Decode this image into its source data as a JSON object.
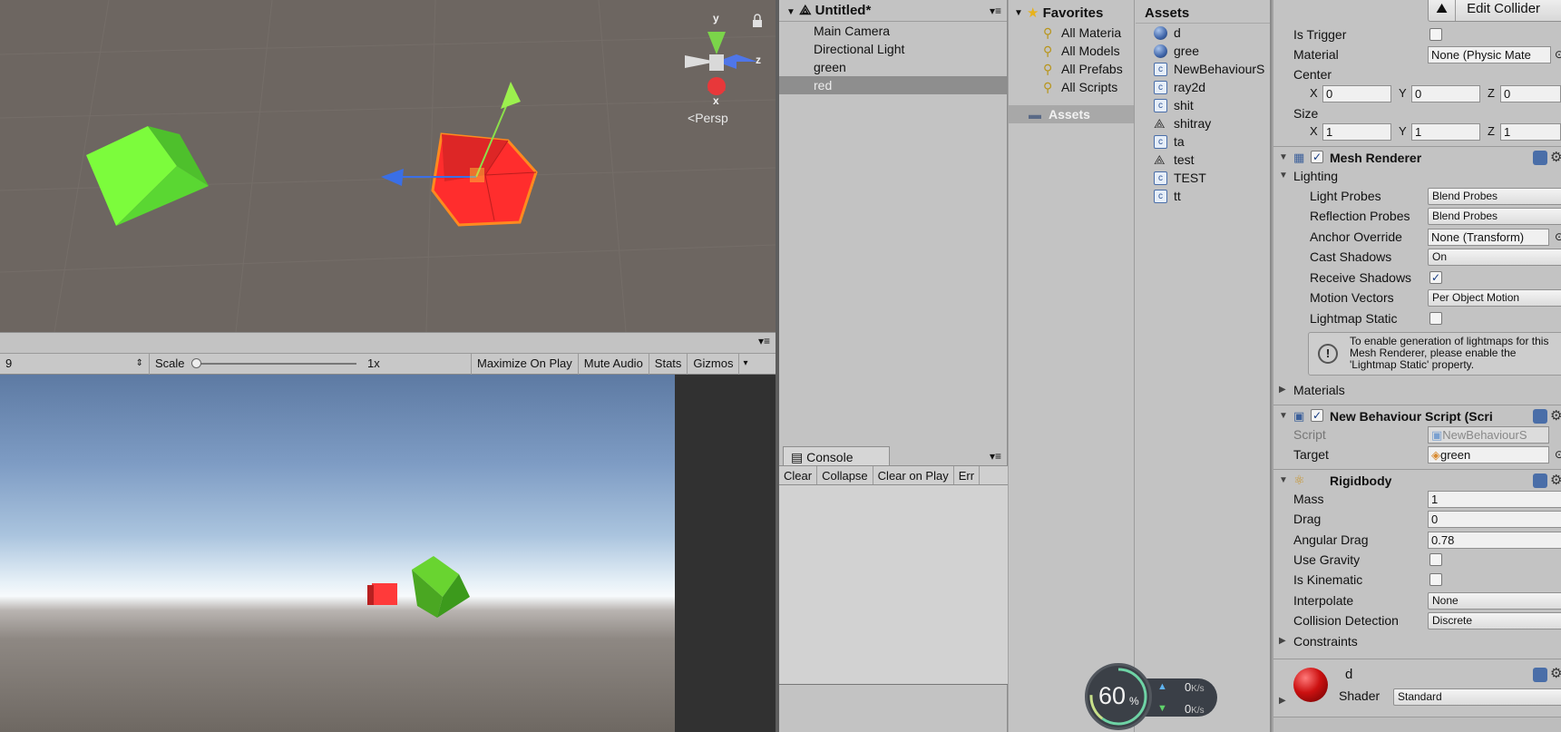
{
  "scene": {
    "axis_y": "y",
    "axis_z": "z",
    "axis_x": "x",
    "persp_label": "Persp",
    "colors": {
      "background": "#6d6661",
      "green_cube": "#7cfc3c",
      "red_cube": "#ff2d2d"
    }
  },
  "game_toolbar": {
    "display_value": "9",
    "scale_label": "Scale",
    "scale_value": "1x",
    "maximize": "Maximize On Play",
    "mute": "Mute Audio",
    "stats": "Stats",
    "gizmos": "Gizmos"
  },
  "hierarchy": {
    "scene_name": "Untitled*",
    "items": [
      "Main Camera",
      "Directional Light",
      "green",
      "red"
    ],
    "selected": "red"
  },
  "console": {
    "tab_label": "Console",
    "buttons": [
      "Clear",
      "Collapse",
      "Clear on Play",
      "Err"
    ]
  },
  "project": {
    "favorites_label": "Favorites",
    "favorites": [
      "All Materia",
      "All Models",
      "All Prefabs",
      "All Scripts"
    ],
    "assets_folder": "Assets",
    "assets_header": "Assets",
    "assets": [
      {
        "name": "d",
        "icon": "material-sphere-icon"
      },
      {
        "name": "gree",
        "icon": "material-sphere-icon"
      },
      {
        "name": "NewBehaviourS",
        "icon": "script-icon"
      },
      {
        "name": "ray2d",
        "icon": "script-icon"
      },
      {
        "name": "shit",
        "icon": "script-icon"
      },
      {
        "name": "shitray",
        "icon": "unity-scene-icon"
      },
      {
        "name": "ta",
        "icon": "script-icon"
      },
      {
        "name": "test",
        "icon": "unity-scene-icon"
      },
      {
        "name": "TEST",
        "icon": "script-icon"
      },
      {
        "name": "tt",
        "icon": "script-icon"
      }
    ]
  },
  "network": {
    "percent": "60",
    "percent_sign": "%",
    "up": "0",
    "down": "0",
    "unit": "K/s"
  },
  "inspector": {
    "edit_collider": "Edit Collider",
    "is_trigger": "Is Trigger",
    "material_label": "Material",
    "material_value": "None (Physic Mate",
    "center_label": "Center",
    "center": {
      "x": "0",
      "y": "0",
      "z": "0"
    },
    "size_label": "Size",
    "size": {
      "x": "1",
      "y": "1",
      "z": "1"
    },
    "x": "X",
    "y": "Y",
    "z": "Z",
    "mesh_renderer": {
      "title": "Mesh Renderer",
      "lighting": "Lighting",
      "light_probes_label": "Light Probes",
      "light_probes": "Blend Probes",
      "reflection_probes_label": "Reflection Probes",
      "reflection_probes": "Blend Probes",
      "anchor_override_label": "Anchor Override",
      "anchor_override": "None (Transform)",
      "cast_shadows_label": "Cast Shadows",
      "cast_shadows": "On",
      "receive_shadows_label": "Receive Shadows",
      "motion_vectors_label": "Motion Vectors",
      "motion_vectors": "Per Object Motion",
      "lightmap_static_label": "Lightmap Static",
      "info": "To enable generation of lightmaps for this Mesh Renderer, please enable the 'Lightmap Static' property.",
      "materials": "Materials"
    },
    "behaviour": {
      "title": "New Behaviour Script (Scri",
      "script_label": "Script",
      "script_value": "NewBehaviourS",
      "target_label": "Target",
      "target_value": "green"
    },
    "rigidbody": {
      "title": "Rigidbody",
      "mass_label": "Mass",
      "mass": "1",
      "drag_label": "Drag",
      "drag": "0",
      "angular_drag_label": "Angular Drag",
      "angular_drag": "0.78",
      "use_gravity_label": "Use Gravity",
      "is_kinematic_label": "Is Kinematic",
      "interpolate_label": "Interpolate",
      "interpolate": "None",
      "collision_label": "Collision Detection",
      "collision": "Discrete",
      "constraints": "Constraints"
    },
    "material": {
      "name": "d",
      "shader_label": "Shader",
      "shader": "Standard"
    }
  }
}
